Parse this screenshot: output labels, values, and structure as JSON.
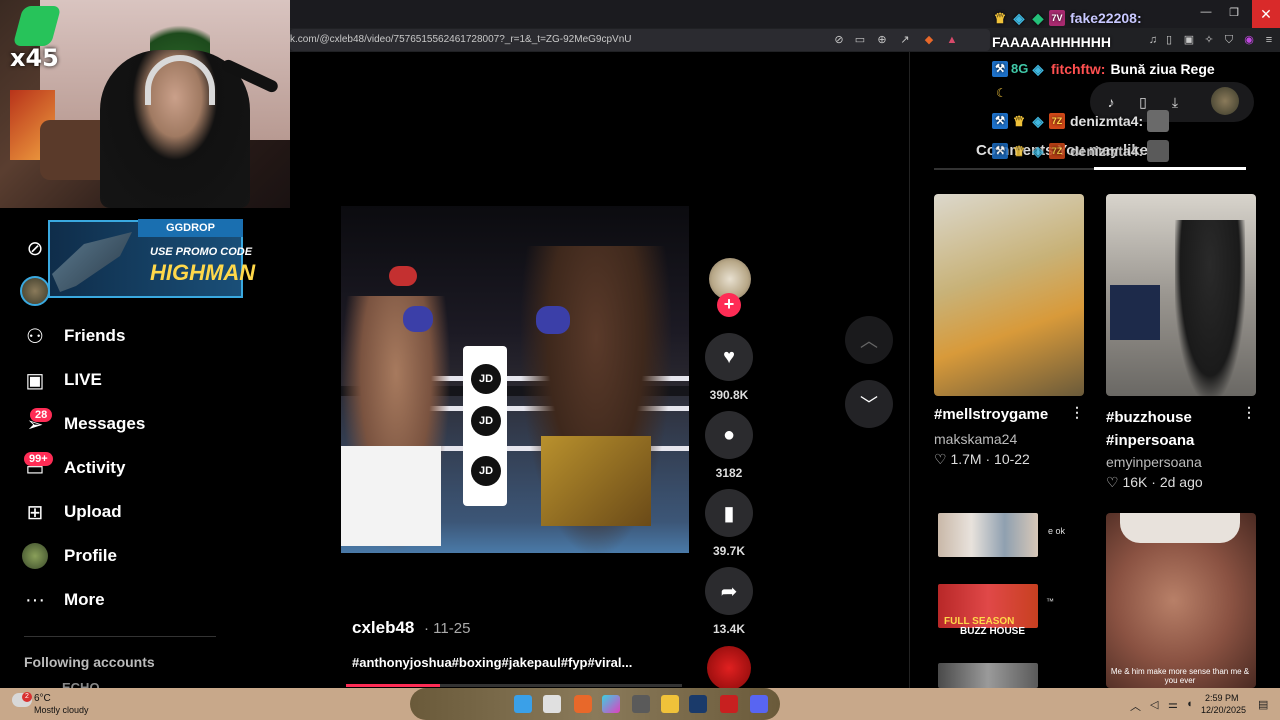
{
  "browser": {
    "url": "k.com/@cxleb48/video/7576515562461728007?_r=1&_t=ZG-92MeG9cpVnU",
    "window_controls": {
      "minimize": "—",
      "maximize": "❐",
      "close": "✕"
    },
    "toolbar_icons": [
      "no-entry",
      "cast",
      "zoom",
      "share",
      "shield",
      "triangle"
    ]
  },
  "webcam": {
    "gem_count": "x45"
  },
  "promo": {
    "brand": "GGDROP",
    "line1": "USE PROMO CODE",
    "code": "HIGHMAN"
  },
  "sidebar": {
    "partial_top": "",
    "items": [
      {
        "label": "Friends",
        "icon": "friends-icon"
      },
      {
        "label": "LIVE",
        "icon": "live-icon"
      },
      {
        "label": "Messages",
        "icon": "messages-icon",
        "badge": "28"
      },
      {
        "label": "Activity",
        "icon": "activity-icon",
        "badge": "99+"
      },
      {
        "label": "Upload",
        "icon": "upload-icon"
      },
      {
        "label": "Profile",
        "icon": "profile-icon"
      },
      {
        "label": "More",
        "icon": "more-icon"
      }
    ],
    "following_header": "Following accounts",
    "following_first": "ECHO"
  },
  "video": {
    "author": "cxleb48",
    "date": "· 11-25",
    "caption": "#anthonyjoshua#boxing#jakepaul#fyp#viral...",
    "progress": 0.28,
    "ring_text": [
      "JD",
      "JD",
      "JD"
    ]
  },
  "actions": {
    "likes": "390.8K",
    "comments": "3182",
    "saves": "39.7K",
    "shares": "13.4K",
    "follow_plus": "+"
  },
  "right_panel": {
    "tabs_text": "Comments   You may like",
    "videos": [
      {
        "title": "#mellstroygame",
        "author": "makskama24",
        "likes": "1.7M",
        "date": "10-22"
      },
      {
        "title": "#buzzhouse #inpersoana",
        "author": "emyinpersoana",
        "likes": "16K",
        "date": "2d ago"
      }
    ],
    "mini_labels": {
      "mini1": "e ok",
      "mini2_top": "FULL SEASON",
      "mini2_bot": "BUZZ HOUSE",
      "mini2_small": "™"
    },
    "thumb3_caption": "Me & him make more sense than me & you ever"
  },
  "chat": [
    {
      "badges": [
        "crown",
        "bot",
        "gem",
        "7tv"
      ],
      "user": "fake22208:",
      "user_color": "#c8c8ff",
      "message": ""
    },
    {
      "badges": [],
      "user": "",
      "user_color": "#fff",
      "message": "FAAAAAHHHHHH"
    },
    {
      "badges": [
        "hammer",
        "8g",
        "bot"
      ],
      "user": "fitchftw:",
      "user_color": "#ff5050",
      "message": "Bună ziua Rege"
    },
    {
      "badges": [
        "hammer",
        "crown",
        "bot",
        "7z"
      ],
      "user": "denizmta4:",
      "user_color": "#e0e0e0",
      "message": ""
    },
    {
      "badges": [
        "hammer",
        "crown",
        "bot",
        "7z"
      ],
      "user": "denizmta4:",
      "user_color": "#e0e0e0",
      "message": ""
    }
  ],
  "taskbar": {
    "temp": "6°C",
    "condition": "Mostly cloudy",
    "weather_badge": "2",
    "time": "2:59 PM",
    "date": "12/20/2025"
  }
}
